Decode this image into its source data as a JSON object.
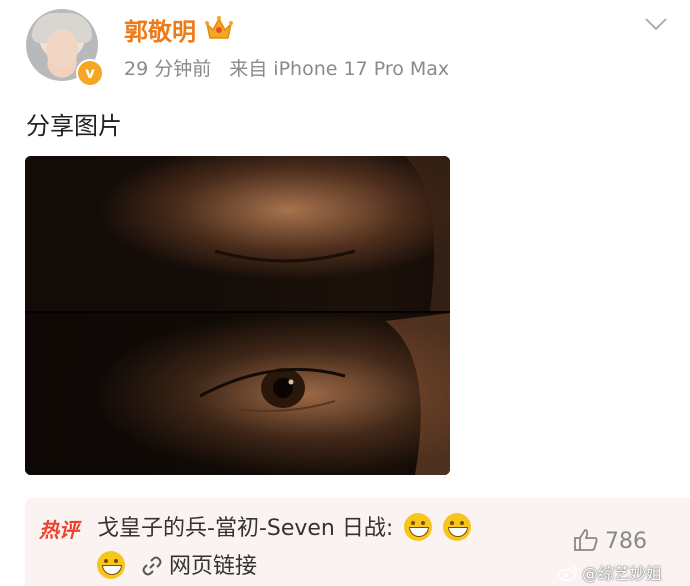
{
  "post": {
    "username": "郭敬明",
    "time": "29 分钟前",
    "source": "来自 iPhone 17 Pro Max",
    "text": "分享图片"
  },
  "icons": {
    "verify": "verified-badge-icon",
    "crown": "crown-icon",
    "more": "chevron-down-icon",
    "link": "link-icon",
    "like": "thumb-up-icon",
    "weibo": "weibo-icon"
  },
  "image": {
    "description_alt": "分享图片"
  },
  "hot_comment": {
    "tag": "热评",
    "author": "戈皇子的兵-當初-Seven 日战",
    "separator": ":",
    "link_text": "网页链接",
    "likes": "786"
  },
  "watermark": {
    "text": "@综艺妙姐"
  },
  "colors": {
    "username": "#ef7a1a",
    "hot_tag": "#e8442e",
    "comment_bg": "#fbf3f2",
    "meta": "#8a8a8a"
  }
}
